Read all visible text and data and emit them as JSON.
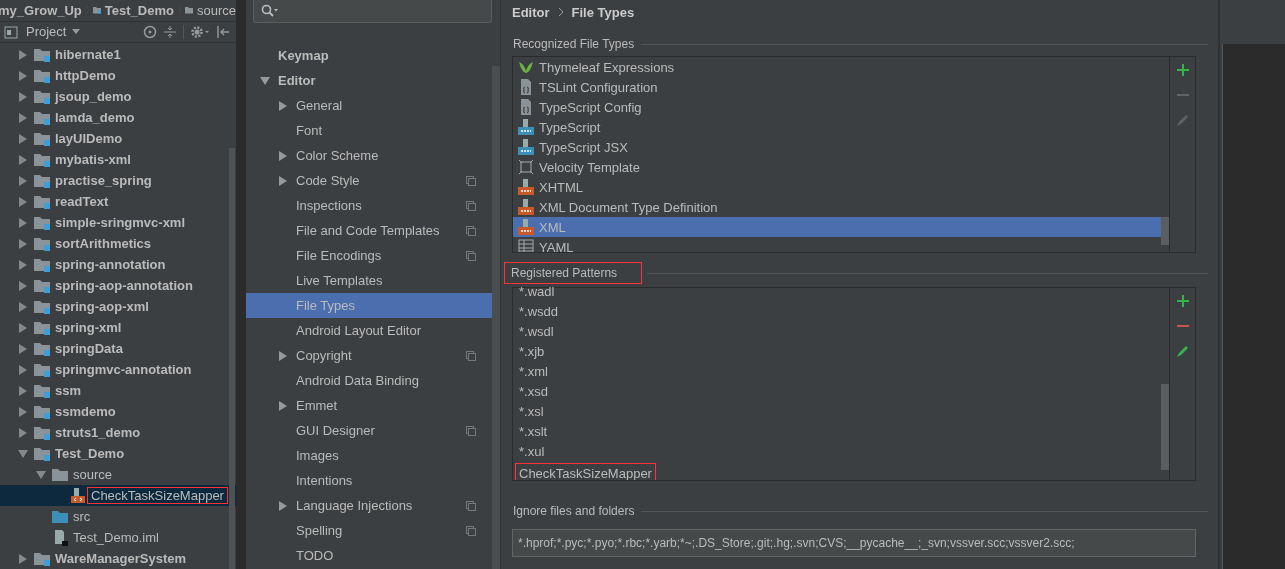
{
  "breadcrumbs": [
    {
      "label": "my_Grow_Up",
      "kind": "module"
    },
    {
      "label": "Test_Demo",
      "kind": "module"
    },
    {
      "label": "source",
      "kind": "folder"
    }
  ],
  "project_panel": {
    "title": "Project",
    "tree": [
      {
        "name": "hibernate1",
        "kind": "module",
        "expanded": false,
        "selected": false
      },
      {
        "name": "httpDemo",
        "kind": "module",
        "expanded": false,
        "selected": false
      },
      {
        "name": "jsoup_demo",
        "kind": "module",
        "expanded": false,
        "selected": false
      },
      {
        "name": "lamda_demo",
        "kind": "module",
        "expanded": false,
        "selected": false
      },
      {
        "name": "layUIDemo",
        "kind": "module",
        "expanded": false,
        "selected": false
      },
      {
        "name": "mybatis-xml",
        "kind": "module",
        "expanded": false,
        "selected": false
      },
      {
        "name": "practise_spring",
        "kind": "module",
        "expanded": false,
        "selected": false
      },
      {
        "name": "readText",
        "kind": "module",
        "expanded": false,
        "selected": false
      },
      {
        "name": "simple-sringmvc-xml",
        "kind": "module",
        "expanded": false,
        "selected": false
      },
      {
        "name": "sortArithmetics",
        "kind": "module",
        "expanded": false,
        "selected": false
      },
      {
        "name": "spring-annotation",
        "kind": "module",
        "expanded": false,
        "selected": false
      },
      {
        "name": "spring-aop-annotation",
        "kind": "module",
        "expanded": false,
        "selected": false
      },
      {
        "name": "spring-aop-xml",
        "kind": "module",
        "expanded": false,
        "selected": false
      },
      {
        "name": "spring-xml",
        "kind": "module",
        "expanded": false,
        "selected": false
      },
      {
        "name": "springData",
        "kind": "module",
        "expanded": false,
        "selected": false
      },
      {
        "name": "springmvc-annotation",
        "kind": "module",
        "expanded": false,
        "selected": false
      },
      {
        "name": "ssm",
        "kind": "module",
        "expanded": false,
        "selected": false
      },
      {
        "name": "ssmdemo",
        "kind": "module",
        "expanded": false,
        "selected": false
      },
      {
        "name": "struts1_demo",
        "kind": "module",
        "expanded": false,
        "selected": false
      },
      {
        "name": "Test_Demo",
        "kind": "module",
        "expanded": true,
        "selected": false,
        "children": [
          {
            "name": "source",
            "kind": "folder",
            "expanded": true,
            "selected": false,
            "children": [
              {
                "name": "CheckTaskSizeMapper",
                "kind": "xml_file",
                "selected": true,
                "annotated": true
              }
            ]
          },
          {
            "name": "src",
            "kind": "source_folder",
            "selected": false
          },
          {
            "name": "Test_Demo.iml",
            "kind": "iml_file",
            "selected": false
          }
        ]
      },
      {
        "name": "WareManagerSystem",
        "kind": "module",
        "expanded": false,
        "selected": false
      }
    ]
  },
  "settings_tree": [
    {
      "label": "Keymap",
      "selected": false
    },
    {
      "label": "Editor",
      "expanded": true,
      "selected": false,
      "children": [
        {
          "label": "General",
          "expanded": false,
          "selected": false
        },
        {
          "label": "Font",
          "selected": false
        },
        {
          "label": "Color Scheme",
          "expanded": false,
          "selected": false
        },
        {
          "label": "Code Style",
          "expanded": false,
          "project_level": true,
          "selected": false
        },
        {
          "label": "Inspections",
          "project_level": true,
          "selected": false
        },
        {
          "label": "File and Code Templates",
          "project_level": true,
          "selected": false
        },
        {
          "label": "File Encodings",
          "project_level": true,
          "selected": false
        },
        {
          "label": "Live Templates",
          "selected": false
        },
        {
          "label": "File Types",
          "selected": true
        },
        {
          "label": "Android Layout Editor",
          "selected": false
        },
        {
          "label": "Copyright",
          "expanded": false,
          "project_level": true,
          "selected": false
        },
        {
          "label": "Android Data Binding",
          "selected": false
        },
        {
          "label": "Emmet",
          "expanded": false,
          "selected": false
        },
        {
          "label": "GUI Designer",
          "project_level": true,
          "selected": false
        },
        {
          "label": "Images",
          "selected": false
        },
        {
          "label": "Intentions",
          "selected": false
        },
        {
          "label": "Language Injections",
          "expanded": false,
          "project_level": true,
          "selected": false
        },
        {
          "label": "Spelling",
          "project_level": true,
          "selected": false
        },
        {
          "label": "TODO",
          "selected": false
        }
      ]
    }
  ],
  "content": {
    "breadcrumb": [
      "Editor",
      "File Types"
    ],
    "recognized": {
      "title": "Recognized File Types",
      "items": [
        {
          "label": "Thymeleaf Expressions",
          "kind": "thymeleaf",
          "selected": false
        },
        {
          "label": "TSLint Configuration",
          "kind": "config",
          "selected": false
        },
        {
          "label": "TypeScript Config",
          "kind": "config",
          "selected": false
        },
        {
          "label": "TypeScript",
          "kind": "ts",
          "selected": false
        },
        {
          "label": "TypeScript JSX",
          "kind": "tsx",
          "selected": false
        },
        {
          "label": "Velocity Template",
          "kind": "velocity",
          "selected": false
        },
        {
          "label": "XHTML",
          "kind": "xhtml",
          "selected": false
        },
        {
          "label": "XML Document Type Definition",
          "kind": "dtd",
          "selected": false
        },
        {
          "label": "XML",
          "kind": "xml",
          "selected": true
        },
        {
          "label": "YAML",
          "kind": "yaml",
          "selected": false
        }
      ],
      "toolbar": [
        {
          "kind": "add",
          "enabled": true
        },
        {
          "kind": "remove",
          "enabled": false
        },
        {
          "kind": "edit",
          "enabled": false
        }
      ]
    },
    "patterns": {
      "title": "Registered Patterns",
      "annotated": true,
      "items": [
        {
          "label": "*.wadl",
          "selected": false
        },
        {
          "label": "*.wsdd",
          "selected": false
        },
        {
          "label": "*.wsdl",
          "selected": false
        },
        {
          "label": "*.xjb",
          "selected": false
        },
        {
          "label": "*.xml",
          "selected": false
        },
        {
          "label": "*.xsd",
          "selected": false
        },
        {
          "label": "*.xsl",
          "selected": false
        },
        {
          "label": "*.xslt",
          "selected": false
        },
        {
          "label": "*.xul",
          "selected": false
        },
        {
          "label": "CheckTaskSizeMapper",
          "selected": false,
          "annotated": true
        }
      ],
      "toolbar": [
        {
          "kind": "add",
          "enabled": true
        },
        {
          "kind": "remove",
          "enabled": true
        },
        {
          "kind": "edit",
          "enabled": true
        }
      ]
    },
    "ignore": {
      "title": "Ignore files and folders",
      "value": "*.hprof;*.pyc;*.pyo;*.rbc;*.yarb;*~;.DS_Store;.git;.hg;.svn;CVS;__pycache__;_svn;vssver.scc;vssver2.scc;"
    }
  }
}
